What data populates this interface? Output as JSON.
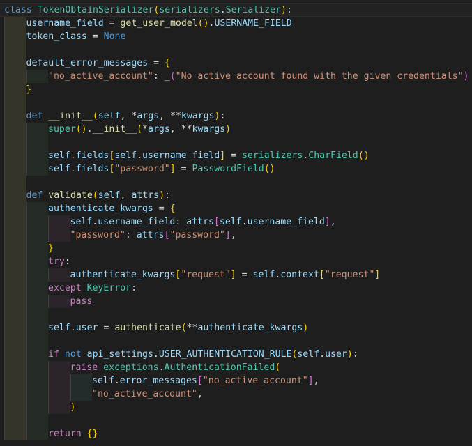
{
  "editor": {
    "language": "python",
    "theme_colors": {
      "background": "#1e1e1e",
      "keyword": "#569cd6",
      "control": "#c586c0",
      "class": "#4ec9b0",
      "function": "#dcdcaa",
      "variable": "#9cdcfe",
      "string": "#ce9178",
      "bracket1": "#ffd700",
      "bracket2": "#da70d6",
      "bracket3": "#179fff"
    },
    "lines": [
      {
        "indent": 0,
        "tokens": [
          [
            "kw",
            "class"
          ],
          [
            "op",
            " "
          ],
          [
            "cls",
            "TokenObtainSerializer"
          ],
          [
            "b1",
            "("
          ],
          [
            "cls",
            "serializers"
          ],
          [
            "op",
            "."
          ],
          [
            "cls",
            "Serializer"
          ],
          [
            "b1",
            ")"
          ],
          [
            "op",
            ":"
          ]
        ]
      },
      {
        "indent": 1,
        "tokens": [
          [
            "var",
            "username_field"
          ],
          [
            "op",
            " = "
          ],
          [
            "fn",
            "get_user_model"
          ],
          [
            "b1",
            "("
          ],
          [
            "b1",
            ")"
          ],
          [
            "op",
            "."
          ],
          [
            "var",
            "USERNAME_FIELD"
          ]
        ]
      },
      {
        "indent": 1,
        "tokens": [
          [
            "var",
            "token_class"
          ],
          [
            "op",
            " = "
          ],
          [
            "kw",
            "None"
          ]
        ]
      },
      {
        "indent": 0,
        "tokens": []
      },
      {
        "indent": 1,
        "tokens": [
          [
            "var",
            "default_error_messages"
          ],
          [
            "op",
            " = "
          ],
          [
            "b1",
            "{"
          ]
        ]
      },
      {
        "indent": 2,
        "tokens": [
          [
            "str",
            "\"no_active_account\""
          ],
          [
            "op",
            ": "
          ],
          [
            "fn",
            "_"
          ],
          [
            "b2",
            "("
          ],
          [
            "str",
            "\"No active account found with the given credentials\""
          ],
          [
            "b2",
            ")"
          ]
        ]
      },
      {
        "indent": 1,
        "tokens": [
          [
            "b1",
            "}"
          ]
        ]
      },
      {
        "indent": 0,
        "tokens": []
      },
      {
        "indent": 1,
        "tokens": [
          [
            "kw",
            "def"
          ],
          [
            "op",
            " "
          ],
          [
            "fn",
            "__init__"
          ],
          [
            "b1",
            "("
          ],
          [
            "var",
            "self"
          ],
          [
            "op",
            ", *"
          ],
          [
            "var",
            "args"
          ],
          [
            "op",
            ", **"
          ],
          [
            "var",
            "kwargs"
          ],
          [
            "b1",
            ")"
          ],
          [
            "op",
            ":"
          ]
        ]
      },
      {
        "indent": 2,
        "tokens": [
          [
            "cls",
            "super"
          ],
          [
            "b1",
            "("
          ],
          [
            "b1",
            ")"
          ],
          [
            "op",
            "."
          ],
          [
            "fn",
            "__init__"
          ],
          [
            "b1",
            "("
          ],
          [
            "op",
            "*"
          ],
          [
            "var",
            "args"
          ],
          [
            "op",
            ", **"
          ],
          [
            "var",
            "kwargs"
          ],
          [
            "b1",
            ")"
          ]
        ]
      },
      {
        "indent": 0,
        "tokens": []
      },
      {
        "indent": 2,
        "tokens": [
          [
            "var",
            "self"
          ],
          [
            "op",
            "."
          ],
          [
            "var",
            "fields"
          ],
          [
            "b1",
            "["
          ],
          [
            "var",
            "self"
          ],
          [
            "op",
            "."
          ],
          [
            "var",
            "username_field"
          ],
          [
            "b1",
            "]"
          ],
          [
            "op",
            " = "
          ],
          [
            "cls",
            "serializers"
          ],
          [
            "op",
            "."
          ],
          [
            "cls",
            "CharField"
          ],
          [
            "b1",
            "("
          ],
          [
            "b1",
            ")"
          ]
        ]
      },
      {
        "indent": 2,
        "tokens": [
          [
            "var",
            "self"
          ],
          [
            "op",
            "."
          ],
          [
            "var",
            "fields"
          ],
          [
            "b1",
            "["
          ],
          [
            "str",
            "\"password\""
          ],
          [
            "b1",
            "]"
          ],
          [
            "op",
            " = "
          ],
          [
            "cls",
            "PasswordField"
          ],
          [
            "b1",
            "("
          ],
          [
            "b1",
            ")"
          ]
        ]
      },
      {
        "indent": 0,
        "tokens": []
      },
      {
        "indent": 1,
        "tokens": [
          [
            "kw",
            "def"
          ],
          [
            "op",
            " "
          ],
          [
            "fn",
            "validate"
          ],
          [
            "b1",
            "("
          ],
          [
            "var",
            "self"
          ],
          [
            "op",
            ", "
          ],
          [
            "var",
            "attrs"
          ],
          [
            "b1",
            ")"
          ],
          [
            "op",
            ":"
          ]
        ]
      },
      {
        "indent": 2,
        "tokens": [
          [
            "var",
            "authenticate_kwargs"
          ],
          [
            "op",
            " = "
          ],
          [
            "b1",
            "{"
          ]
        ]
      },
      {
        "indent": 3,
        "tokens": [
          [
            "var",
            "self"
          ],
          [
            "op",
            "."
          ],
          [
            "var",
            "username_field"
          ],
          [
            "op",
            ": "
          ],
          [
            "var",
            "attrs"
          ],
          [
            "b2",
            "["
          ],
          [
            "var",
            "self"
          ],
          [
            "op",
            "."
          ],
          [
            "var",
            "username_field"
          ],
          [
            "b2",
            "]"
          ],
          [
            "op",
            ","
          ]
        ]
      },
      {
        "indent": 3,
        "tokens": [
          [
            "str",
            "\"password\""
          ],
          [
            "op",
            ": "
          ],
          [
            "var",
            "attrs"
          ],
          [
            "b2",
            "["
          ],
          [
            "str",
            "\"password\""
          ],
          [
            "b2",
            "]"
          ],
          [
            "op",
            ","
          ]
        ]
      },
      {
        "indent": 2,
        "tokens": [
          [
            "b1",
            "}"
          ]
        ]
      },
      {
        "indent": 2,
        "tokens": [
          [
            "ctl",
            "try"
          ],
          [
            "op",
            ":"
          ]
        ]
      },
      {
        "indent": 3,
        "tokens": [
          [
            "var",
            "authenticate_kwargs"
          ],
          [
            "b1",
            "["
          ],
          [
            "str",
            "\"request\""
          ],
          [
            "b1",
            "]"
          ],
          [
            "op",
            " = "
          ],
          [
            "var",
            "self"
          ],
          [
            "op",
            "."
          ],
          [
            "var",
            "context"
          ],
          [
            "b1",
            "["
          ],
          [
            "str",
            "\"request\""
          ],
          [
            "b1",
            "]"
          ]
        ]
      },
      {
        "indent": 2,
        "tokens": [
          [
            "ctl",
            "except"
          ],
          [
            "op",
            " "
          ],
          [
            "cls",
            "KeyError"
          ],
          [
            "op",
            ":"
          ]
        ]
      },
      {
        "indent": 3,
        "tokens": [
          [
            "ctl",
            "pass"
          ]
        ]
      },
      {
        "indent": 0,
        "tokens": []
      },
      {
        "indent": 2,
        "tokens": [
          [
            "var",
            "self"
          ],
          [
            "op",
            "."
          ],
          [
            "var",
            "user"
          ],
          [
            "op",
            " = "
          ],
          [
            "fn",
            "authenticate"
          ],
          [
            "b1",
            "("
          ],
          [
            "op",
            "**"
          ],
          [
            "var",
            "authenticate_kwargs"
          ],
          [
            "b1",
            ")"
          ]
        ]
      },
      {
        "indent": 0,
        "tokens": []
      },
      {
        "indent": 2,
        "tokens": [
          [
            "ctl",
            "if"
          ],
          [
            "op",
            " "
          ],
          [
            "kw",
            "not"
          ],
          [
            "op",
            " "
          ],
          [
            "var",
            "api_settings"
          ],
          [
            "op",
            "."
          ],
          [
            "var",
            "USER_AUTHENTICATION_RULE"
          ],
          [
            "b1",
            "("
          ],
          [
            "var",
            "self"
          ],
          [
            "op",
            "."
          ],
          [
            "var",
            "user"
          ],
          [
            "b1",
            ")"
          ],
          [
            "op",
            ":"
          ]
        ]
      },
      {
        "indent": 3,
        "tokens": [
          [
            "ctl",
            "raise"
          ],
          [
            "op",
            " "
          ],
          [
            "cls",
            "exceptions"
          ],
          [
            "op",
            "."
          ],
          [
            "cls",
            "AuthenticationFailed"
          ],
          [
            "b1",
            "("
          ]
        ]
      },
      {
        "indent": 4,
        "tokens": [
          [
            "var",
            "self"
          ],
          [
            "op",
            "."
          ],
          [
            "var",
            "error_messages"
          ],
          [
            "b2",
            "["
          ],
          [
            "str",
            "\"no_active_account\""
          ],
          [
            "b2",
            "]"
          ],
          [
            "op",
            ","
          ]
        ]
      },
      {
        "indent": 4,
        "tokens": [
          [
            "str",
            "\"no_active_account\""
          ],
          [
            "op",
            ","
          ]
        ]
      },
      {
        "indent": 3,
        "tokens": [
          [
            "b1",
            ")"
          ]
        ]
      },
      {
        "indent": 0,
        "tokens": []
      },
      {
        "indent": 2,
        "tokens": [
          [
            "ctl",
            "return"
          ],
          [
            "op",
            " "
          ],
          [
            "b1",
            "{"
          ],
          [
            "b1",
            "}"
          ]
        ]
      }
    ]
  }
}
